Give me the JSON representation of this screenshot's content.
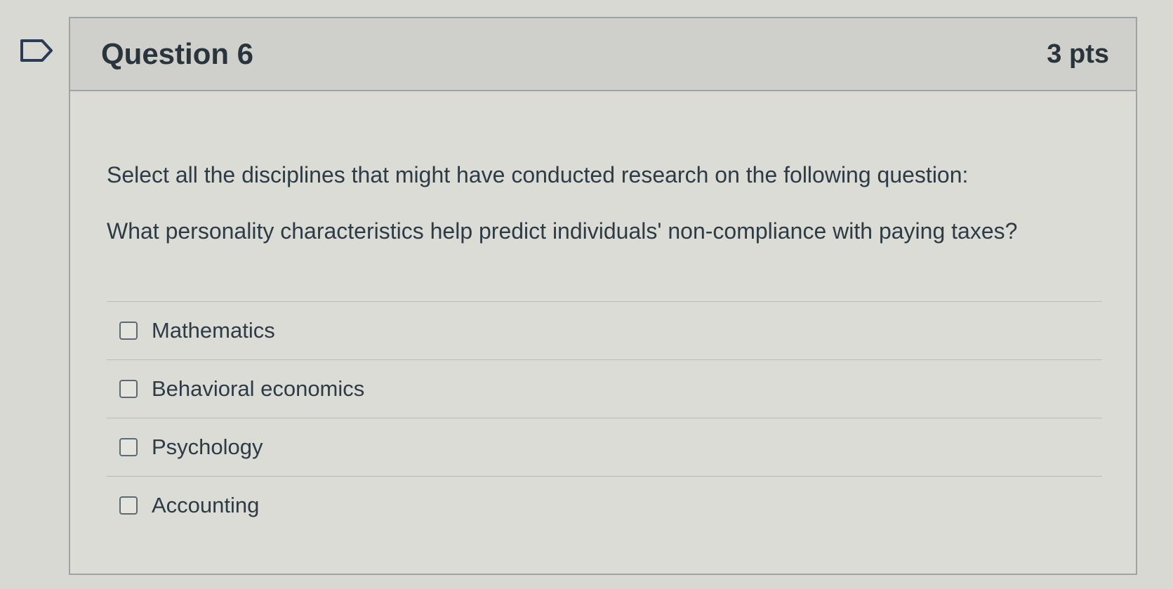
{
  "question": {
    "title": "Question 6",
    "points": "3 pts",
    "prompt": "Select all the disciplines that might have conducted research on the following question:",
    "subprompt": "What personality characteristics help predict individuals' non-compliance with paying taxes?",
    "answers": [
      {
        "label": "Mathematics",
        "checked": false
      },
      {
        "label": "Behavioral economics",
        "checked": false
      },
      {
        "label": "Psychology",
        "checked": false
      },
      {
        "label": "Accounting",
        "checked": false
      }
    ]
  },
  "icons": {
    "bookmark": "bookmark-flag-icon"
  },
  "colors": {
    "header_bg": "#cfd0cc",
    "border": "#9ea3a4",
    "text": "#2d3b45"
  }
}
